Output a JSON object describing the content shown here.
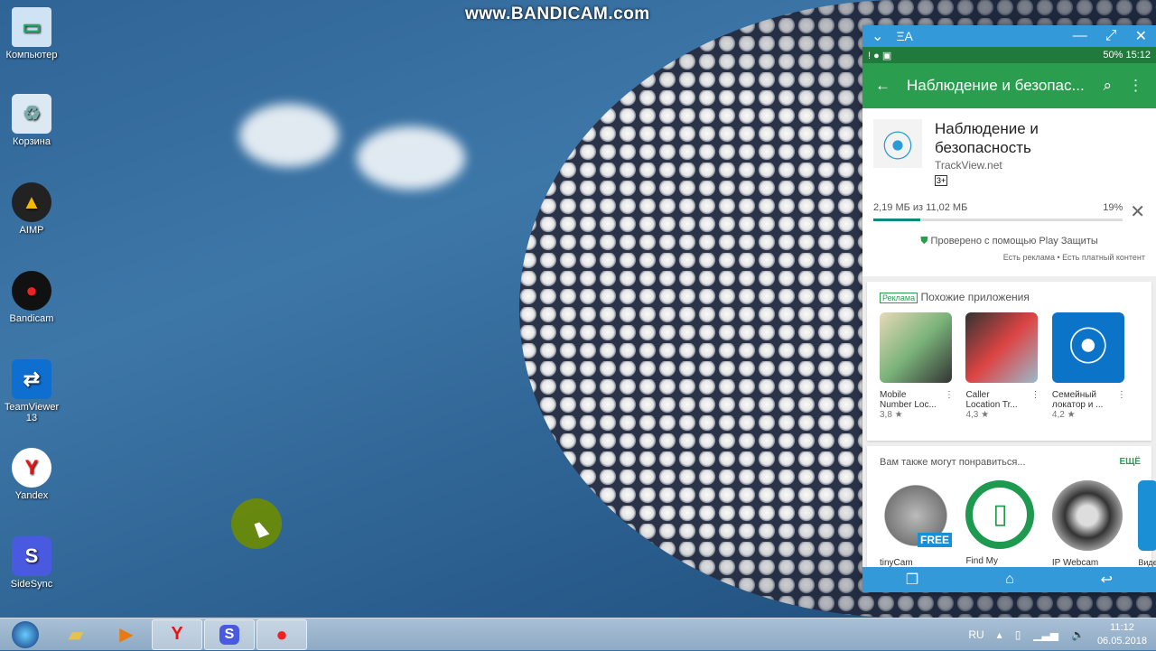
{
  "watermark": "www.BANDICAM.com",
  "desktop_icons": [
    {
      "label": "Компьютер",
      "icon": "computer-icon"
    },
    {
      "label": "Корзина",
      "icon": "recycle-bin-icon"
    },
    {
      "label": "AIMP",
      "icon": "aimp-icon"
    },
    {
      "label": "Bandicam",
      "icon": "bandicam-icon"
    },
    {
      "label": "TeamViewer 13",
      "icon": "teamviewer-icon"
    },
    {
      "label": "Yandex",
      "icon": "yandex-icon"
    },
    {
      "label": "SideSync",
      "icon": "sidesync-icon"
    }
  ],
  "taskbar": {
    "lang": "RU",
    "time": "11:12",
    "date": "06.05.2018"
  },
  "phone": {
    "window_icon": "ΞA",
    "status_right": "50% 15:12",
    "appbar_title": "Наблюдение и безопас...",
    "app": {
      "title_line1": "Наблюдение и",
      "title_line2": "безопасность",
      "developer": "TrackView.net",
      "rating_badge": "3+"
    },
    "download": {
      "text": "2,19 МБ из 11,02 МБ",
      "percent_label": "19%",
      "progress": 19
    },
    "verified": "Проверено с помощью Play Защиты",
    "notes": "Есть реклама • Есть платный контент",
    "similar": {
      "ad_badge": "Реклама",
      "title": "Похожие приложения",
      "apps": [
        {
          "name1": "Mobile",
          "name2": "Number Loc...",
          "rating": "3,8 ★"
        },
        {
          "name1": "Caller",
          "name2": "Location Tr...",
          "rating": "4,3 ★"
        },
        {
          "name1": "Семейный",
          "name2": "локатор и ...",
          "rating": "4,2 ★"
        }
      ]
    },
    "recommended": {
      "title": "Вам также могут понравиться...",
      "more": "ЕЩЁ",
      "free_badge": "FREE",
      "apps": [
        "tinyCam",
        "Find My",
        "IP Webcam",
        "Виде"
      ]
    }
  }
}
